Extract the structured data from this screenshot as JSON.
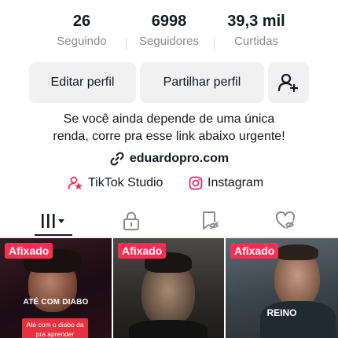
{
  "stats": {
    "following": {
      "value": "26",
      "label": "Seguindo"
    },
    "followers": {
      "value": "6998",
      "label": "Seguidores"
    },
    "likes": {
      "value": "39,3 mil",
      "label": "Curtidas"
    }
  },
  "actions": {
    "edit_label": "Editar perfil",
    "share_label": "Partilhar perfil",
    "add_friends_icon": "add-user-icon"
  },
  "bio": {
    "line1": "Se você ainda depende de uma única",
    "line2": "renda, corre pra esse link abaixo urgente!"
  },
  "link": {
    "icon": "link-icon",
    "text": "eduardopro.com"
  },
  "apps": {
    "studio": {
      "icon": "tiktok-studio-icon",
      "label": "TikTok Studio",
      "color": "#fe2c55"
    },
    "instagram": {
      "icon": "instagram-icon",
      "label": "Instagram",
      "color": "#e1306c"
    }
  },
  "tabs": [
    {
      "name": "videos",
      "icon": "grid-bars-icon",
      "active": true
    },
    {
      "name": "private",
      "icon": "lock-icon",
      "active": false
    },
    {
      "name": "saved",
      "icon": "bookmark-hidden-icon",
      "active": false
    },
    {
      "name": "liked",
      "icon": "heart-hidden-icon",
      "active": false
    }
  ],
  "videos": [
    {
      "pinned_label": "Afixado",
      "caption": "ATÉ COM DIABO",
      "subtitle": "Até com o diabo da pra aprender"
    },
    {
      "pinned_label": "Afixado",
      "caption": ""
    },
    {
      "pinned_label": "Afixado",
      "caption": "REINO"
    }
  ],
  "colors": {
    "accent": "#fe2c55",
    "text": "#161823",
    "muted": "#8a8b91",
    "button_bg": "#f1f1f2"
  }
}
